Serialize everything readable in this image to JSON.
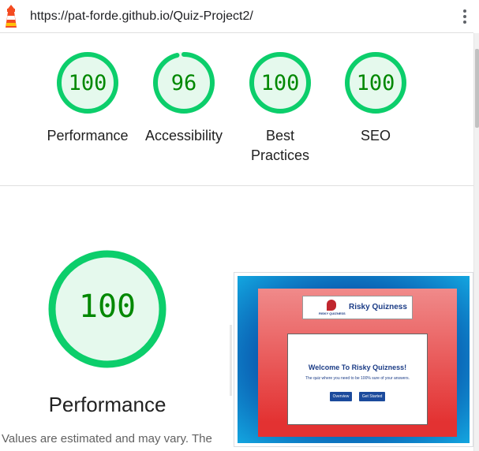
{
  "browser": {
    "url": "https://pat-forde.github.io/Quiz-Project2/",
    "icons": {
      "logo": "lighthouse-icon",
      "menu": "more-vert-icon"
    }
  },
  "gauges": [
    {
      "score": "100",
      "label": "Performance",
      "value": 100
    },
    {
      "score": "96",
      "label": "Accessibility",
      "value": 96
    },
    {
      "score": "100",
      "label": "Best Practices",
      "value": 100
    },
    {
      "score": "100",
      "label": "SEO",
      "value": 100
    }
  ],
  "performance": {
    "score": "100",
    "value": 100,
    "title": "Performance",
    "disclaimer": "Values are estimated and may vary. The"
  },
  "screenshot": {
    "brand": "Risky Quizness",
    "logo_text": "RISKY QUIZNESS",
    "welcome": "Welcome To Risky Quizness!",
    "subtitle": "The quiz where you need to be 100% sure of your answers.",
    "buttons": [
      "Overview",
      "Get Started"
    ]
  },
  "colors": {
    "pass": "#0cce6b",
    "pass_fill": "#e5f9ed",
    "pass_text": "#008800"
  }
}
